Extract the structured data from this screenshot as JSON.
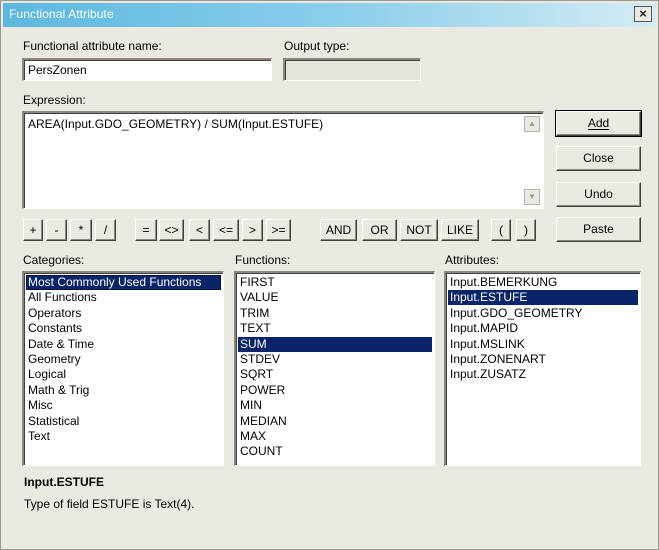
{
  "window": {
    "title": "Functional Attribute",
    "close_glyph": "×"
  },
  "fields": {
    "name_label": "Functional attribute name:",
    "name_value": "PersZonen",
    "output_label": "Output type:",
    "output_value": ""
  },
  "expression": {
    "label": "Expression:",
    "value": "AREA(Input.GDO_GEOMETRY) / SUM(Input.ESTUFE)"
  },
  "buttons": {
    "add": "Add",
    "close": "Close",
    "undo": "Undo",
    "paste": "Paste"
  },
  "operators": [
    "+",
    "-",
    "*",
    "/",
    "=",
    "<>",
    "<",
    "<=",
    ">",
    ">=",
    "AND",
    "OR",
    "NOT",
    "LIKE",
    "(",
    ")"
  ],
  "categories": {
    "label": "Categories:",
    "items": [
      "Most Commonly Used Functions",
      "All Functions",
      "Operators",
      "Constants",
      "Date & Time",
      "Geometry",
      "Logical",
      "Math & Trig",
      "Misc",
      "Statistical",
      "Text"
    ],
    "selected": 0
  },
  "functions": {
    "label": "Functions:",
    "items": [
      "FIRST",
      "VALUE",
      "TRIM",
      "TEXT",
      "SUM",
      "STDEV",
      "SQRT",
      "POWER",
      "MIN",
      "MEDIAN",
      "MAX",
      "COUNT"
    ],
    "selected": 4
  },
  "attributes": {
    "label": "Attributes:",
    "items": [
      "Input.BEMERKUNG",
      "Input.ESTUFE",
      "Input.GDO_GEOMETRY",
      "Input.MAPID",
      "Input.MSLINK",
      "Input.ZONENART",
      "Input.ZUSATZ"
    ],
    "selected": 1
  },
  "status": {
    "title": "Input.ESTUFE",
    "description": "Type of field ESTUFE is Text(4)."
  },
  "colors": {
    "titlebar_start": "#5bb8e0",
    "selection": "#0a246a",
    "dialog_bg": "#ece9e2"
  }
}
